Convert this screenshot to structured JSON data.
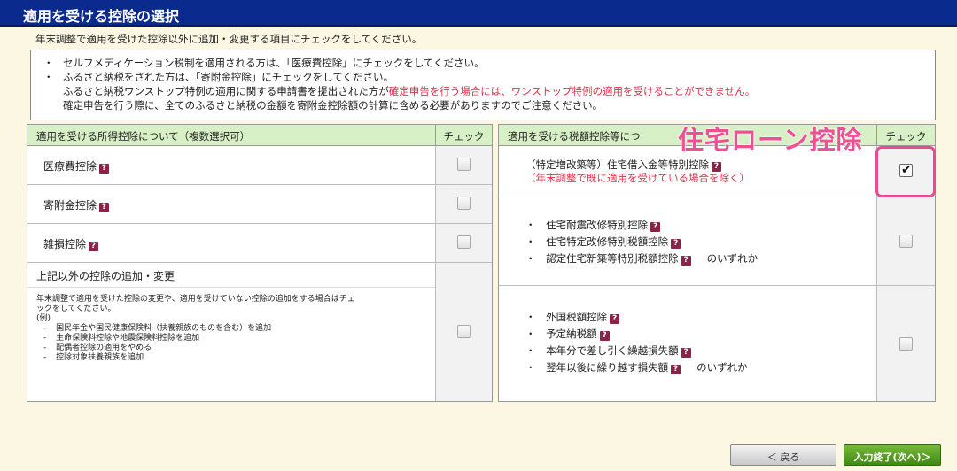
{
  "page": {
    "title": "適用を受ける控除の選択",
    "instruction": "年末調整で適用を受けた控除以外に追加・変更する項目にチェックをしてください。"
  },
  "notes": {
    "bullet": "・",
    "line1": "セルフメディケーション税制を適用される方は、「医療費控除」にチェックをしてください。",
    "line2": "ふるさと納税をされた方は、「寄附金控除」にチェックをしてください。",
    "line3a": "ふるさと納税ワンストップ特例の適用に関する申請書を提出された方が",
    "line3b": "確定申告を行う場合には、ワンストップ特例の適用を受けることができません。",
    "line4": "確定申告を行う際に、全てのふるさと納税の金額を寄附金控除額の計算に含める必要がありますのでご注意ください。"
  },
  "left_panel": {
    "header": "適用を受ける所得控除について（複数選択可）",
    "check_header": "チェック",
    "items": [
      {
        "label": "医療費控除",
        "checked": false
      },
      {
        "label": "寄附金控除",
        "checked": false
      },
      {
        "label": "雑損控除",
        "checked": false
      }
    ],
    "other": {
      "title": "上記以外の控除の追加・変更",
      "desc1": "年末調整で適用を受けた控除の変更や、適用を受けていない控除の追加をする場合はチェ",
      "desc2": "ックをしてください。",
      "example": "(例)",
      "ex1": "国民年金や国民健康保険料（扶養親族のものを含む）を追加",
      "ex2": "生命保険料控除や地震保険料控除を追加",
      "ex3": "配偶者控除の適用をやめる",
      "ex4": "控除対象扶養親族を追加",
      "checked": false
    }
  },
  "right_panel": {
    "header": "適用を受ける税額控除等につ",
    "check_header": "チェック",
    "group1": {
      "line1": "（特定増改築等）住宅借入金等特別控除",
      "line2": "（年末調整で既に適用を受けている場合を除く）",
      "checked": true
    },
    "group2": {
      "item1": "住宅耐震改修特別控除",
      "item2": "住宅特定改修特別税額控除",
      "item3": "認定住宅新築等特別税額控除",
      "suffix": "のいずれか",
      "checked": false
    },
    "group3": {
      "item1": "外国税額控除",
      "item2": "予定納税額",
      "item3": "本年分で差し引く繰越損失額",
      "item4": "翌年以後に繰り越す損失額",
      "suffix": "のいずれか",
      "checked": false
    }
  },
  "overlay": {
    "label": "住宅ローン控除",
    "color": "#ee4f95"
  },
  "buttons": {
    "back": "＜ 戻る",
    "next": "入力終了(次へ)＞"
  },
  "icons": {
    "help": "?",
    "check": "✔"
  }
}
